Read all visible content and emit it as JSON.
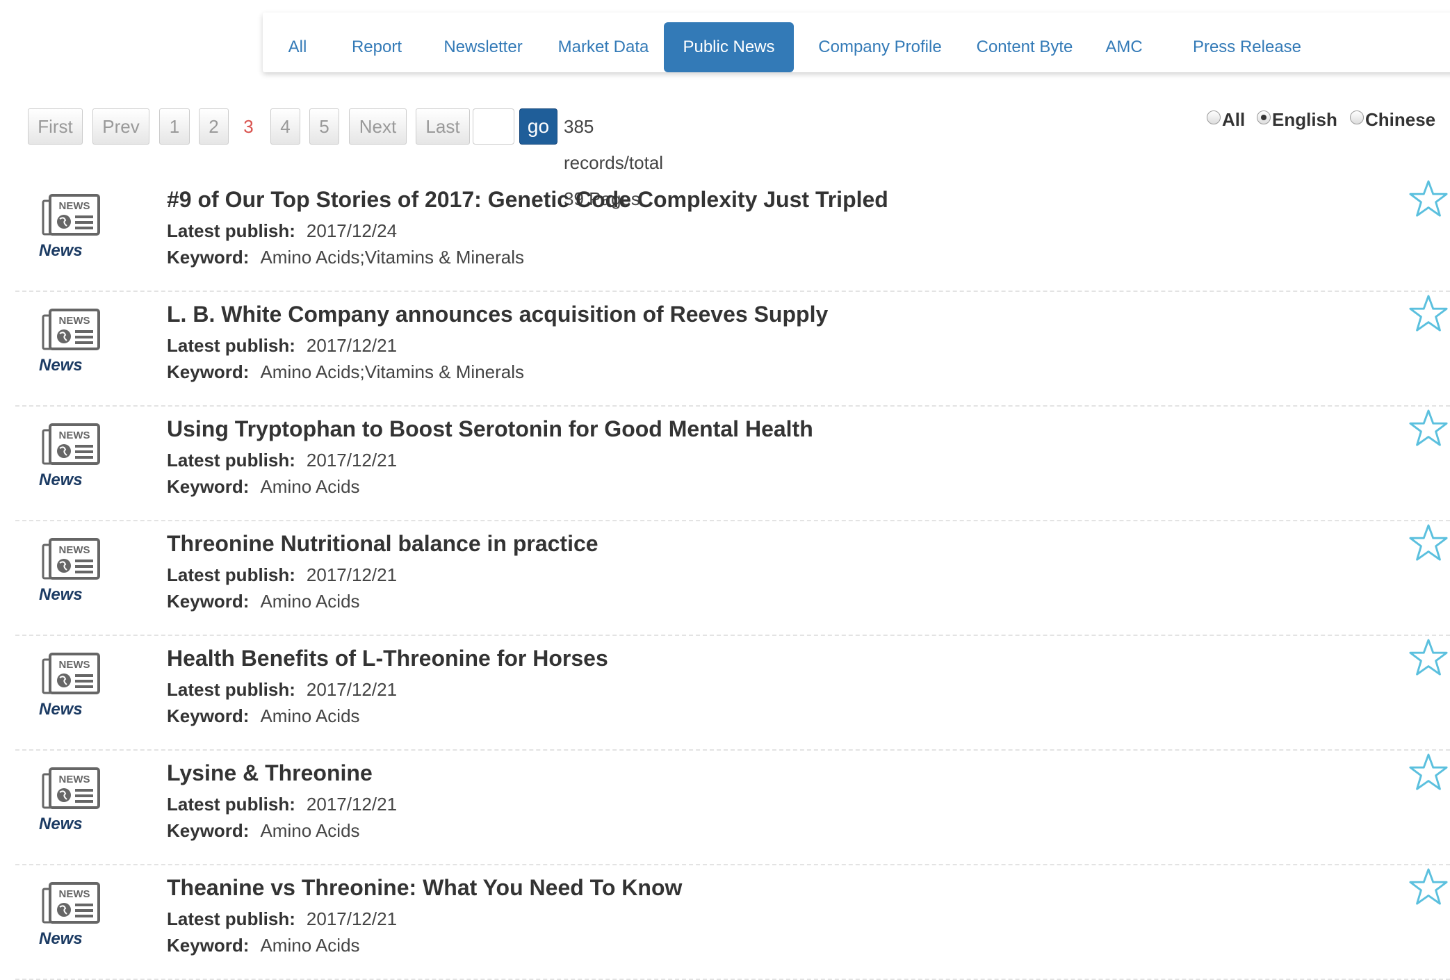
{
  "tabs": [
    {
      "label": "All",
      "active": false
    },
    {
      "label": "Report",
      "active": false
    },
    {
      "label": "Newsletter",
      "active": false
    },
    {
      "label": "Market Data",
      "active": false
    },
    {
      "label": "Public News",
      "active": true
    },
    {
      "label": "Company Profile",
      "active": false
    },
    {
      "label": "Content Byte",
      "active": false
    },
    {
      "label": "AMC",
      "active": false
    },
    {
      "label": "Press Release",
      "active": false
    }
  ],
  "pagination": {
    "first": "First",
    "prev": "Prev",
    "pages": [
      "1",
      "2",
      "3",
      "4",
      "5"
    ],
    "current_page": "3",
    "next": "Next",
    "last": "Last",
    "page_input_value": "",
    "go": "go",
    "summary": "385 records/total 39 Pages"
  },
  "language_filter": {
    "options": [
      "All",
      "English",
      "Chinese"
    ],
    "selected": "English"
  },
  "labels": {
    "latest_publish": "Latest publish:",
    "keyword": "Keyword:",
    "icon_text": "NEWS"
  },
  "items": [
    {
      "type": "News",
      "title": "#9 of Our Top Stories of 2017: Genetic Code Complexity Just Tripled",
      "date": "2017/12/24",
      "keyword": "Amino Acids;Vitamins & Minerals"
    },
    {
      "type": "News",
      "title": "L. B. White Company announces acquisition of Reeves Supply",
      "date": "2017/12/21",
      "keyword": "Amino Acids;Vitamins & Minerals"
    },
    {
      "type": "News",
      "title": "Using Tryptophan to Boost Serotonin for Good Mental Health",
      "date": "2017/12/21",
      "keyword": "Amino Acids"
    },
    {
      "type": "News",
      "title": "Threonine Nutritional balance in practice",
      "date": "2017/12/21",
      "keyword": "Amino Acids"
    },
    {
      "type": "News",
      "title": "Health Benefits of L-Threonine for Horses",
      "date": "2017/12/21",
      "keyword": "Amino Acids"
    },
    {
      "type": "News",
      "title": "Lysine & Threonine",
      "date": "2017/12/21",
      "keyword": "Amino Acids"
    },
    {
      "type": "News",
      "title": "Theanine vs Threonine: What You Need To Know",
      "date": "2017/12/21",
      "keyword": "Amino Acids"
    }
  ],
  "colors": {
    "accent": "#337ab7",
    "go_button": "#1f5e99",
    "current_page": "#d9534f",
    "star": "#5bc0de"
  },
  "icons": {
    "item_icon": "newspaper-icon",
    "favorite": "star-outline-icon"
  }
}
